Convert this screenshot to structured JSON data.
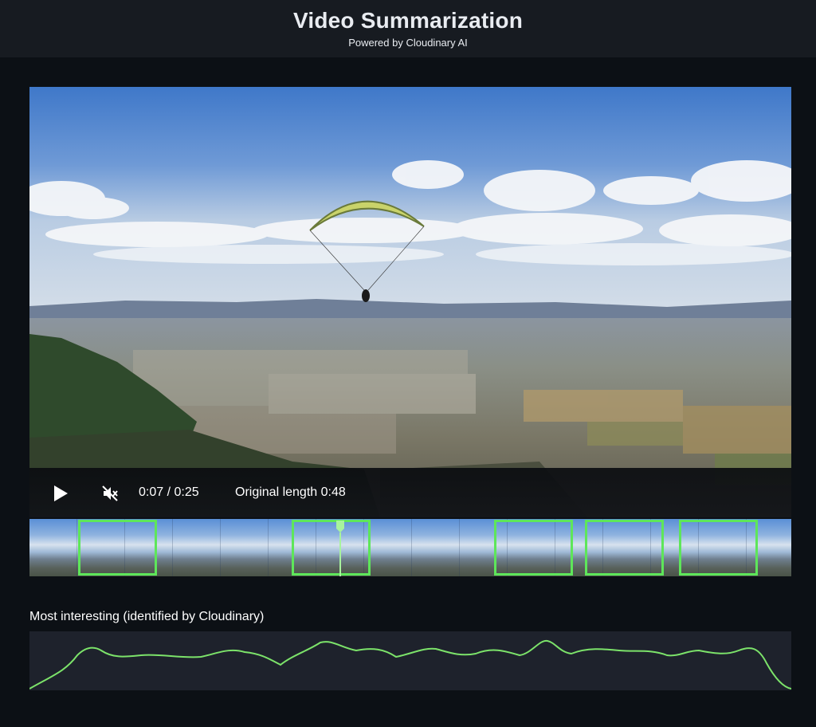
{
  "header": {
    "title": "Video Summarization",
    "subtitle": "Powered by Cloudinary AI"
  },
  "player": {
    "play_icon": "play-icon",
    "mute_icon": "muted-speaker-icon",
    "time": "0:07 / 0:25",
    "original_length": "Original length 0:48",
    "scene": "paraglider over city and valley"
  },
  "timeline": {
    "highlight_color": "#5ee65a",
    "playhead_progress": 0.28
  },
  "interest_graph": {
    "label": "Most interesting (identified by Cloudinary)",
    "line_color": "#7ce36a"
  }
}
